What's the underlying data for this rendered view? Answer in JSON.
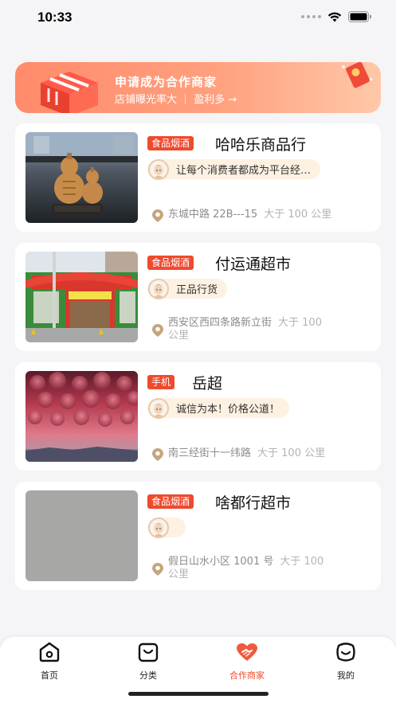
{
  "status": {
    "time": "10:33"
  },
  "banner": {
    "title": "申请成为合作商家",
    "subtitle": "店铺曝光率大 ｜ 盈利多 →"
  },
  "shops": [
    {
      "tag": "食品烟酒",
      "name": "哈哈乐商品行",
      "slogan": "让每个消费者都成为平台经…",
      "address": "东城中路 22B---15",
      "distance": "大于 100 公里"
    },
    {
      "tag": "食品烟酒",
      "name": "付运通超市",
      "slogan": "正品行货",
      "address": "西安区西四条路新立街",
      "distance": "大于 100",
      "distance_line2": "公里"
    },
    {
      "tag": "手机",
      "name": "岳超",
      "slogan": "诚信为本！价格公道！",
      "address": "南三经街十一纬路",
      "distance": "大于 100 公里"
    },
    {
      "tag": "食品烟酒",
      "name": "啥都行超市",
      "slogan": "",
      "address": "假日山水小区 1001 号",
      "distance": "大于 100",
      "distance_line2": "公里"
    }
  ],
  "tabbar": {
    "home": "首页",
    "category": "分类",
    "partner": "合作商家",
    "mine": "我的"
  },
  "colors": {
    "accent": "#ef4a2d",
    "banner": "#ff8b6a"
  }
}
